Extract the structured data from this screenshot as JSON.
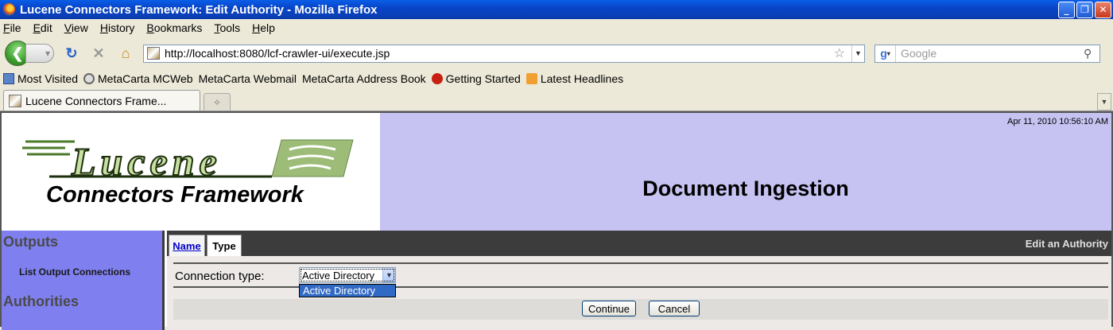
{
  "window": {
    "title": "Lucene Connectors Framework: Edit Authority - Mozilla Firefox",
    "minimize": "_",
    "maximize": "❐",
    "close": "✕"
  },
  "menu": [
    "File",
    "Edit",
    "View",
    "History",
    "Bookmarks",
    "Tools",
    "Help"
  ],
  "toolbar": {
    "url": "http://localhost:8080/lcf-crawler-ui/execute.jsp",
    "search_placeholder": "Google"
  },
  "bookmarks": [
    {
      "label": "Most Visited",
      "icon": "most-visited-icon"
    },
    {
      "label": "MetaCarta MCWeb",
      "icon": "metacarta-icon"
    },
    {
      "label": "MetaCarta Webmail",
      "icon": "page-icon"
    },
    {
      "label": "MetaCarta Address Book",
      "icon": "page-icon"
    },
    {
      "label": "Getting Started",
      "icon": "getting-started-icon"
    },
    {
      "label": "Latest Headlines",
      "icon": "rss-icon"
    }
  ],
  "browser_tab": {
    "label": "Lucene Connectors Frame..."
  },
  "page": {
    "logo_word": "Lucene",
    "logo_sub": "Connectors Framework",
    "datetime": "Apr 11, 2010 10:56:10 AM",
    "header_title": "Document Ingestion",
    "sidebar": {
      "outputs_heading": "Outputs",
      "outputs_item": "List Output Connections",
      "authorities_heading": "Authorities"
    },
    "tabs": {
      "name": "Name",
      "type": "Type"
    },
    "section_title": "Edit an Authority",
    "form": {
      "connection_type_label": "Connection type:",
      "connection_type_value": "Active Directory",
      "dropdown_option": "Active Directory",
      "continue_label": "Continue",
      "cancel_label": "Cancel"
    }
  },
  "colors": {
    "header_right_bg": "#c6c3f2",
    "sidebar_bg": "#7f7ff0",
    "tabsbar_bg": "#3c3c3c",
    "selection_blue": "#316ac5"
  }
}
